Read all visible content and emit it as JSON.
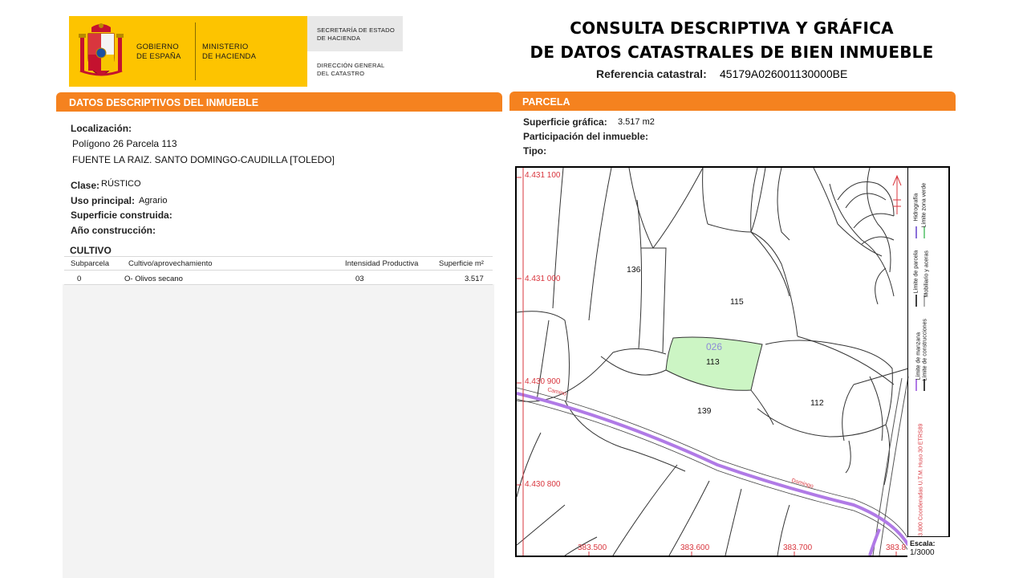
{
  "header": {
    "logo": {
      "gobierno_line1": "GOBIERNO",
      "gobierno_line2": "DE ESPAÑA",
      "ministerio_line1": "MINISTERIO",
      "ministerio_line2": "DE HACIENDA",
      "secretaria_line1": "SECRETARÍA DE ESTADO",
      "secretaria_line2": "DE HACIENDA",
      "direccion_line1": "DIRECCIÓN GENERAL",
      "direccion_line2": "DEL CATASTRO"
    },
    "title_line1": "CONSULTA DESCRIPTIVA Y GRÁFICA",
    "title_line2": "DE DATOS CATASTRALES DE BIEN INMUEBLE",
    "referencia_label": "Referencia catastral:",
    "referencia_value": "45179A026001130000BE"
  },
  "descriptivos": {
    "section_title": "DATOS DESCRIPTIVOS DEL INMUEBLE",
    "localizacion_label": "Localización:",
    "localizacion_line1": "Polígono 26 Parcela 113",
    "localizacion_line2": "FUENTE LA RAIZ. SANTO DOMINGO-CAUDILLA [TOLEDO]",
    "clase_label": "Clase:",
    "clase_value": "RÚSTICO",
    "uso_label": "Uso principal:",
    "uso_value": "Agrario",
    "superficie_construida_label": "Superficie construida:",
    "anio_label": "Año construcción:",
    "cultivo": {
      "title": "CULTIVO",
      "columns": [
        "Subparcela",
        "Cultivo/aprovechamiento",
        "Intensidad Productiva",
        "Superficie m²"
      ],
      "rows": [
        {
          "subparcela": "0",
          "cultivo": "O- Olivos secano",
          "intensidad": "03",
          "superficie": "3.517"
        }
      ]
    }
  },
  "parcela": {
    "section_title": "PARCELA",
    "superficie_label": "Superficie gráfica:",
    "superficie_value": "3.517 m2",
    "participacion_label": "Participación del inmueble:",
    "tipo_label": "Tipo:",
    "map": {
      "y_coords": [
        "4.431 100",
        "4.431 000",
        "4.430 900",
        "4.430 800"
      ],
      "x_coords": [
        "383.500",
        "383.600",
        "383.700",
        "383.8"
      ],
      "parcels": [
        "136",
        "115",
        "113",
        "112",
        "139"
      ],
      "poligono": "026",
      "road_labels": [
        "Camino",
        "Domingo"
      ],
      "highlight_color": "#ccf5c4",
      "legend": {
        "hidrografia": "Hidrografía",
        "limite_zona_verde": "Límite zona verde",
        "limite_parcela": "Límite de parcela",
        "mobiliario": "Mobiliario y aceras",
        "limite_manzana": "Límite de manzana",
        "limite_construcciones": "Límite de construcciones",
        "coordenadas": "383.800 Coordenadas U.T.M. Huso 30 ETRS89"
      },
      "escala_label": "Escala:",
      "escala_value": "1/3000"
    }
  },
  "colors": {
    "accent_orange": "#f5821f",
    "logo_yellow": "#fdc400",
    "coordinate_red": "#d9363e",
    "road_purple": "#b07ae6"
  }
}
